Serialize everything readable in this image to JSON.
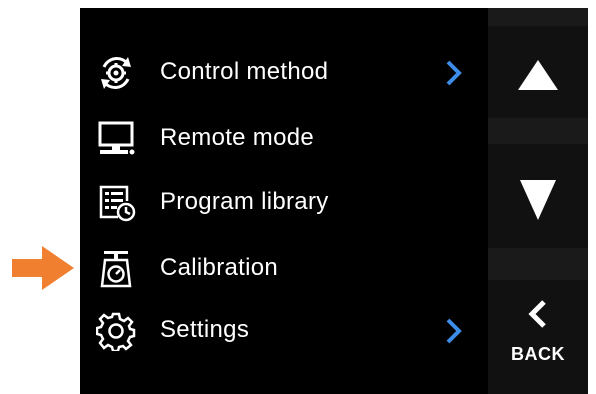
{
  "pointer": {
    "icon": "arrow-right-icon",
    "color": "#f08030"
  },
  "menu": {
    "items": [
      {
        "label": "Control method",
        "icon": "control-method-icon",
        "has_submenu": true
      },
      {
        "label": "Remote mode",
        "icon": "monitor-icon",
        "has_submenu": false
      },
      {
        "label": "Program library",
        "icon": "program-library-icon",
        "has_submenu": false
      },
      {
        "label": "Calibration",
        "icon": "scale-icon",
        "has_submenu": false
      },
      {
        "label": "Settings",
        "icon": "gear-icon",
        "has_submenu": true
      }
    ],
    "chevron_color": "#3c8ce8"
  },
  "side_buttons": {
    "up_icon": "triangle-up-icon",
    "down_icon": "triangle-down-icon",
    "back_icon": "chevron-left-icon",
    "back_label": "BACK"
  }
}
